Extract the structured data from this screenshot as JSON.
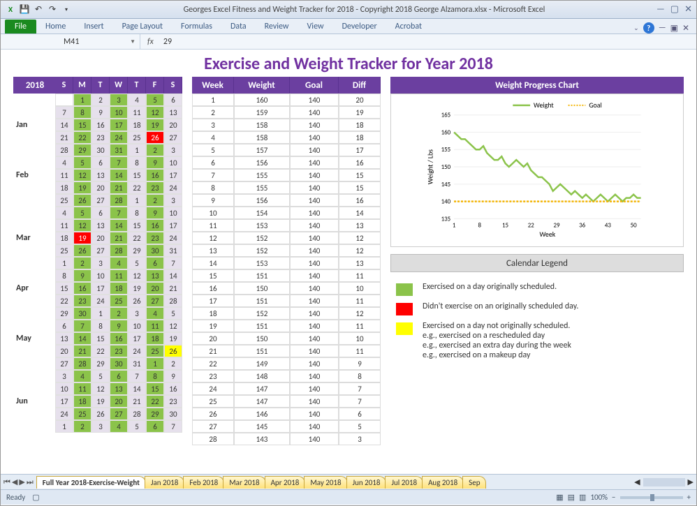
{
  "window": {
    "title": "Georges Excel Fitness and Weight Tracker for 2018 - Copyright 2018 George Alzamora.xlsx  -  Microsoft Excel"
  },
  "ribbon": {
    "file": "File",
    "tabs": [
      "Home",
      "Insert",
      "Page Layout",
      "Formulas",
      "Data",
      "Review",
      "View",
      "Developer",
      "Acrobat"
    ]
  },
  "formula_bar": {
    "name_box": "M41",
    "fx_label": "fx",
    "value": "29"
  },
  "page_title": "Exercise and Weight Tracker for Year 2018",
  "year_label": "2018",
  "day_headers": [
    "S",
    "M",
    "T",
    "W",
    "T",
    "F",
    "S"
  ],
  "months": [
    "Jan",
    "Feb",
    "Mar",
    "Apr",
    "May",
    "Jun"
  ],
  "calendar": [
    [
      [
        "",
        "E"
      ],
      [
        "1",
        "G"
      ],
      [
        "2",
        "L"
      ],
      [
        "3",
        "G"
      ],
      [
        "4",
        "L"
      ],
      [
        "5",
        "G"
      ],
      [
        "6",
        "L"
      ]
    ],
    [
      [
        "7",
        "L"
      ],
      [
        "8",
        "G"
      ],
      [
        "9",
        "L"
      ],
      [
        "10",
        "G"
      ],
      [
        "11",
        "L"
      ],
      [
        "12",
        "G"
      ],
      [
        "13",
        "L"
      ]
    ],
    [
      [
        "14",
        "L"
      ],
      [
        "15",
        "G"
      ],
      [
        "16",
        "L"
      ],
      [
        "17",
        "G"
      ],
      [
        "18",
        "L"
      ],
      [
        "19",
        "G"
      ],
      [
        "20",
        "L"
      ]
    ],
    [
      [
        "21",
        "L"
      ],
      [
        "22",
        "G"
      ],
      [
        "23",
        "L"
      ],
      [
        "24",
        "G"
      ],
      [
        "25",
        "L"
      ],
      [
        "26",
        "R"
      ],
      [
        "27",
        "L"
      ]
    ],
    [
      [
        "28",
        "L"
      ],
      [
        "29",
        "G"
      ],
      [
        "30",
        "L"
      ],
      [
        "31",
        "G"
      ],
      [
        "1",
        "L"
      ],
      [
        "2",
        "G"
      ],
      [
        "3",
        "L"
      ]
    ],
    [
      [
        "4",
        "L"
      ],
      [
        "5",
        "G"
      ],
      [
        "6",
        "L"
      ],
      [
        "7",
        "G"
      ],
      [
        "8",
        "L"
      ],
      [
        "9",
        "G"
      ],
      [
        "10",
        "L"
      ]
    ],
    [
      [
        "11",
        "L"
      ],
      [
        "12",
        "G"
      ],
      [
        "13",
        "L"
      ],
      [
        "14",
        "G"
      ],
      [
        "15",
        "L"
      ],
      [
        "16",
        "G"
      ],
      [
        "17",
        "L"
      ]
    ],
    [
      [
        "18",
        "L"
      ],
      [
        "19",
        "G"
      ],
      [
        "20",
        "L"
      ],
      [
        "21",
        "G"
      ],
      [
        "22",
        "L"
      ],
      [
        "23",
        "G"
      ],
      [
        "24",
        "L"
      ]
    ],
    [
      [
        "25",
        "L"
      ],
      [
        "26",
        "G"
      ],
      [
        "27",
        "L"
      ],
      [
        "28",
        "G"
      ],
      [
        "1",
        "L"
      ],
      [
        "2",
        "G"
      ],
      [
        "3",
        "L"
      ]
    ],
    [
      [
        "4",
        "L"
      ],
      [
        "5",
        "G"
      ],
      [
        "6",
        "L"
      ],
      [
        "7",
        "G"
      ],
      [
        "8",
        "L"
      ],
      [
        "9",
        "G"
      ],
      [
        "10",
        "L"
      ]
    ],
    [
      [
        "11",
        "L"
      ],
      [
        "12",
        "G"
      ],
      [
        "13",
        "L"
      ],
      [
        "14",
        "G"
      ],
      [
        "15",
        "L"
      ],
      [
        "16",
        "G"
      ],
      [
        "17",
        "L"
      ]
    ],
    [
      [
        "18",
        "L"
      ],
      [
        "19",
        "R"
      ],
      [
        "20",
        "L"
      ],
      [
        "21",
        "G"
      ],
      [
        "22",
        "L"
      ],
      [
        "23",
        "G"
      ],
      [
        "24",
        "L"
      ]
    ],
    [
      [
        "25",
        "L"
      ],
      [
        "26",
        "G"
      ],
      [
        "27",
        "L"
      ],
      [
        "28",
        "G"
      ],
      [
        "29",
        "L"
      ],
      [
        "30",
        "G"
      ],
      [
        "31",
        "L"
      ]
    ],
    [
      [
        "1",
        "L"
      ],
      [
        "2",
        "G"
      ],
      [
        "3",
        "L"
      ],
      [
        "4",
        "G"
      ],
      [
        "5",
        "L"
      ],
      [
        "6",
        "G"
      ],
      [
        "7",
        "L"
      ]
    ],
    [
      [
        "8",
        "L"
      ],
      [
        "9",
        "G"
      ],
      [
        "10",
        "L"
      ],
      [
        "11",
        "G"
      ],
      [
        "12",
        "L"
      ],
      [
        "13",
        "G"
      ],
      [
        "14",
        "L"
      ]
    ],
    [
      [
        "15",
        "L"
      ],
      [
        "16",
        "G"
      ],
      [
        "17",
        "L"
      ],
      [
        "18",
        "G"
      ],
      [
        "19",
        "L"
      ],
      [
        "20",
        "G"
      ],
      [
        "21",
        "L"
      ]
    ],
    [
      [
        "22",
        "L"
      ],
      [
        "23",
        "G"
      ],
      [
        "24",
        "L"
      ],
      [
        "25",
        "G"
      ],
      [
        "26",
        "L"
      ],
      [
        "27",
        "G"
      ],
      [
        "28",
        "L"
      ]
    ],
    [
      [
        "29",
        "L"
      ],
      [
        "30",
        "G"
      ],
      [
        "1",
        "L"
      ],
      [
        "2",
        "G"
      ],
      [
        "3",
        "L"
      ],
      [
        "4",
        "G"
      ],
      [
        "5",
        "L"
      ]
    ],
    [
      [
        "6",
        "L"
      ],
      [
        "7",
        "G"
      ],
      [
        "8",
        "L"
      ],
      [
        "9",
        "G"
      ],
      [
        "10",
        "L"
      ],
      [
        "11",
        "G"
      ],
      [
        "12",
        "L"
      ]
    ],
    [
      [
        "13",
        "L"
      ],
      [
        "14",
        "G"
      ],
      [
        "15",
        "L"
      ],
      [
        "16",
        "G"
      ],
      [
        "17",
        "L"
      ],
      [
        "18",
        "G"
      ],
      [
        "19",
        "L"
      ]
    ],
    [
      [
        "20",
        "L"
      ],
      [
        "21",
        "G"
      ],
      [
        "22",
        "L"
      ],
      [
        "23",
        "G"
      ],
      [
        "24",
        "L"
      ],
      [
        "25",
        "G"
      ],
      [
        "26",
        "Y"
      ]
    ],
    [
      [
        "27",
        "L"
      ],
      [
        "28",
        "G"
      ],
      [
        "29",
        "L"
      ],
      [
        "30",
        "G"
      ],
      [
        "31",
        "L"
      ],
      [
        "1",
        "G"
      ],
      [
        "2",
        "L"
      ]
    ],
    [
      [
        "3",
        "L"
      ],
      [
        "4",
        "G"
      ],
      [
        "5",
        "L"
      ],
      [
        "6",
        "G"
      ],
      [
        "7",
        "L"
      ],
      [
        "8",
        "G"
      ],
      [
        "9",
        "L"
      ]
    ],
    [
      [
        "10",
        "L"
      ],
      [
        "11",
        "G"
      ],
      [
        "12",
        "L"
      ],
      [
        "13",
        "G"
      ],
      [
        "14",
        "L"
      ],
      [
        "15",
        "G"
      ],
      [
        "16",
        "L"
      ]
    ],
    [
      [
        "17",
        "L"
      ],
      [
        "18",
        "G"
      ],
      [
        "19",
        "L"
      ],
      [
        "20",
        "G"
      ],
      [
        "21",
        "L"
      ],
      [
        "22",
        "G"
      ],
      [
        "23",
        "L"
      ]
    ],
    [
      [
        "24",
        "L"
      ],
      [
        "25",
        "G"
      ],
      [
        "26",
        "L"
      ],
      [
        "27",
        "G"
      ],
      [
        "28",
        "L"
      ],
      [
        "29",
        "G"
      ],
      [
        "30",
        "L"
      ]
    ],
    [
      [
        "1",
        "L"
      ],
      [
        "2",
        "G"
      ],
      [
        "3",
        "L"
      ],
      [
        "4",
        "G"
      ],
      [
        "5",
        "L"
      ],
      [
        "6",
        "G"
      ],
      [
        "7",
        "L"
      ]
    ]
  ],
  "table": {
    "headers": [
      "Week",
      "Weight",
      "Goal",
      "Diff"
    ],
    "rows": [
      [
        "1",
        "160",
        "140",
        "20"
      ],
      [
        "2",
        "159",
        "140",
        "19"
      ],
      [
        "3",
        "158",
        "140",
        "18"
      ],
      [
        "4",
        "158",
        "140",
        "18"
      ],
      [
        "5",
        "157",
        "140",
        "17"
      ],
      [
        "6",
        "156",
        "140",
        "16"
      ],
      [
        "7",
        "155",
        "140",
        "15"
      ],
      [
        "8",
        "155",
        "140",
        "15"
      ],
      [
        "9",
        "156",
        "140",
        "16"
      ],
      [
        "10",
        "154",
        "140",
        "14"
      ],
      [
        "11",
        "153",
        "140",
        "13"
      ],
      [
        "12",
        "152",
        "140",
        "12"
      ],
      [
        "13",
        "152",
        "140",
        "12"
      ],
      [
        "14",
        "153",
        "140",
        "13"
      ],
      [
        "15",
        "151",
        "140",
        "11"
      ],
      [
        "16",
        "150",
        "140",
        "10"
      ],
      [
        "17",
        "151",
        "140",
        "11"
      ],
      [
        "18",
        "152",
        "140",
        "12"
      ],
      [
        "19",
        "151",
        "140",
        "11"
      ],
      [
        "20",
        "150",
        "140",
        "10"
      ],
      [
        "21",
        "151",
        "140",
        "11"
      ],
      [
        "22",
        "149",
        "140",
        "9"
      ],
      [
        "23",
        "148",
        "140",
        "8"
      ],
      [
        "24",
        "147",
        "140",
        "7"
      ],
      [
        "25",
        "147",
        "140",
        "7"
      ],
      [
        "26",
        "146",
        "140",
        "6"
      ],
      [
        "27",
        "145",
        "140",
        "5"
      ],
      [
        "28",
        "143",
        "140",
        "3"
      ]
    ]
  },
  "chart": {
    "title": "Weight Progress Chart",
    "legend": [
      "Weight",
      "Goal"
    ],
    "ylabel": "Weight / Lbs",
    "xlabel": "Week",
    "yticks": [
      "135",
      "140",
      "145",
      "150",
      "155",
      "160",
      "165"
    ],
    "xticks": [
      "1",
      "8",
      "15",
      "22",
      "29",
      "36",
      "43",
      "50"
    ]
  },
  "chart_data": {
    "type": "line",
    "title": "Weight Progress Chart",
    "xlabel": "Week",
    "ylabel": "Weight / Lbs",
    "ylim": [
      135,
      165
    ],
    "x": [
      1,
      2,
      3,
      4,
      5,
      6,
      7,
      8,
      9,
      10,
      11,
      12,
      13,
      14,
      15,
      16,
      17,
      18,
      19,
      20,
      21,
      22,
      23,
      24,
      25,
      26,
      27,
      28,
      29,
      30,
      31,
      32,
      33,
      34,
      35,
      36,
      37,
      38,
      39,
      40,
      41,
      42,
      43,
      44,
      45,
      46,
      47,
      48,
      49,
      50,
      51,
      52
    ],
    "series": [
      {
        "name": "Weight",
        "color": "#8bc34a",
        "values": [
          160,
          159,
          158,
          158,
          157,
          156,
          155,
          155,
          156,
          154,
          153,
          152,
          152,
          153,
          151,
          150,
          151,
          152,
          151,
          150,
          151,
          149,
          148,
          147,
          147,
          146,
          145,
          143,
          144,
          145,
          144,
          143,
          142,
          143,
          142,
          141,
          142,
          141,
          140,
          141,
          142,
          141,
          140,
          141,
          142,
          141,
          140,
          141,
          141,
          142,
          141,
          141
        ]
      },
      {
        "name": "Goal",
        "color": "#f4b400",
        "values": [
          140,
          140,
          140,
          140,
          140,
          140,
          140,
          140,
          140,
          140,
          140,
          140,
          140,
          140,
          140,
          140,
          140,
          140,
          140,
          140,
          140,
          140,
          140,
          140,
          140,
          140,
          140,
          140,
          140,
          140,
          140,
          140,
          140,
          140,
          140,
          140,
          140,
          140,
          140,
          140,
          140,
          140,
          140,
          140,
          140,
          140,
          140,
          140,
          140,
          140,
          140,
          140
        ]
      }
    ]
  },
  "legend": {
    "title": "Calendar Legend",
    "items": [
      {
        "color": "#8bc34a",
        "text": "Exercised on a day originally scheduled."
      },
      {
        "color": "#ff0000",
        "text": "Didn't exercise on an originally scheduled day."
      },
      {
        "color": "#ffff00",
        "text": "Exercised on a day not originally scheduled.\ne.g., exercised on a rescheduled day\ne.g., exercised an extra day during the week\ne.g., exercised on a makeup day"
      }
    ]
  },
  "sheet_tabs": [
    "Full Year 2018-Exercise-Weight",
    "Jan 2018",
    "Feb 2018",
    "Mar 2018",
    "Apr 2018",
    "May 2018",
    "Jun 2018",
    "Jul 2018",
    "Aug 2018",
    "Sep"
  ],
  "status": {
    "ready": "Ready",
    "zoom": "100%"
  }
}
